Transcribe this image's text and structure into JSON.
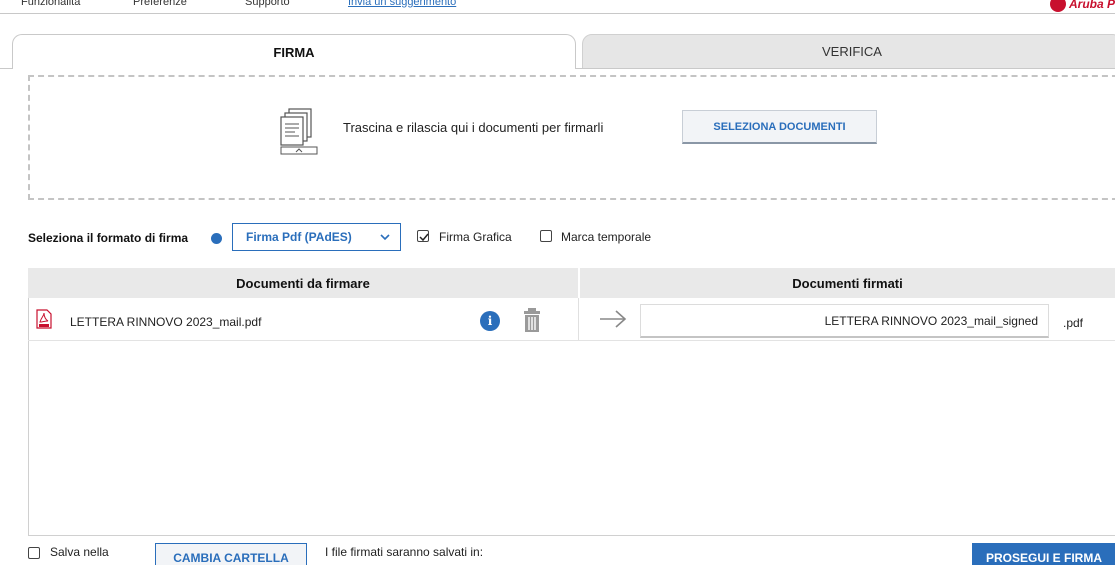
{
  "menu": {
    "items": [
      "Funzionalità",
      "Preferenze",
      "Supporto"
    ],
    "suggest_link": "Invia un suggerimento",
    "brand": "Aruba P"
  },
  "tabs": [
    {
      "label": "FIRMA",
      "active": true
    },
    {
      "label": "VERIFICA",
      "active": false
    }
  ],
  "dropzone": {
    "text": "Trascina e rilascia qui i documenti per firmarli",
    "button": "SELEZIONA DOCUMENTI"
  },
  "format": {
    "label": "Seleziona il formato di firma",
    "selected": "Firma Pdf (PAdES)",
    "firma_grafica": {
      "label": "Firma Grafica",
      "checked": true
    },
    "marca_temporale": {
      "label": "Marca temporale",
      "checked": false
    }
  },
  "table": {
    "col_left": "Documenti da firmare",
    "col_right": "Documenti firmati",
    "rows": [
      {
        "name": "LETTERA RINNOVO 2023_mail.pdf",
        "output_name": "LETTERA RINNOVO 2023_mail_signed",
        "output_ext": ".pdf"
      }
    ]
  },
  "bottom": {
    "save_label": "Salva nella",
    "change_button": "CAMBIA CARTELLA",
    "info_text": "I file firmati saranno salvati in:",
    "proceed_button": "PROSEGUI E FIRMA"
  },
  "colors": {
    "accent": "#2a6ebb",
    "brand": "#c8102e",
    "header_bg": "#e9e9e9"
  }
}
